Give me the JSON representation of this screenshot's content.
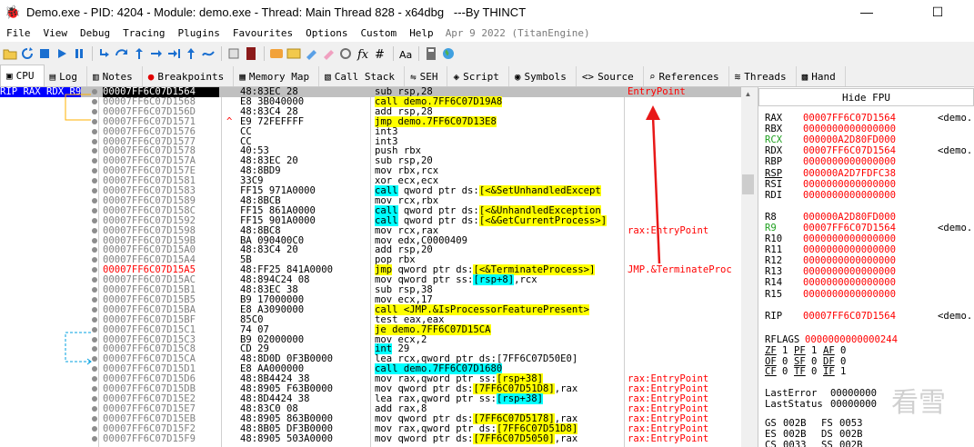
{
  "window": {
    "title": "Demo.exe - PID: 4204 - Module: demo.exe - Thread: Main Thread 828 - x64dbg   ---By THINCT",
    "minimize_glyph": "—",
    "maximize_glyph": "☐"
  },
  "menu": {
    "items": [
      "File",
      "View",
      "Debug",
      "Tracing",
      "Plugins",
      "Favourites",
      "Options",
      "Custom",
      "Help"
    ],
    "date": "Apr 9 2022 (TitanEngine)"
  },
  "toolbar": {
    "icons": [
      "open-icon",
      "restart-icon",
      "stop-icon",
      "run-icon",
      "pause-icon",
      "step-into-icon",
      "step-over-icon",
      "trace-into-icon",
      "trace-over-icon",
      "execute-till-return-icon",
      "run-to-user-code-icon",
      "scylla-icon",
      "notes-icon",
      "patch-icon",
      "comments-icon",
      "labels-icon",
      "bookmarks-icon",
      "functions-icon",
      "variables-icon",
      "font-icon",
      "calculator-icon",
      "globe-icon"
    ]
  },
  "tabs": [
    {
      "label": "CPU",
      "icon": "cpu-icon",
      "glyph": "▣",
      "active": true
    },
    {
      "label": "Log",
      "icon": "log-icon",
      "glyph": "▤"
    },
    {
      "label": "Notes",
      "icon": "notes-icon",
      "glyph": "▥"
    },
    {
      "label": "Breakpoints",
      "icon": "breakpoint-icon",
      "glyph": "●"
    },
    {
      "label": "Memory Map",
      "icon": "memory-map-icon",
      "glyph": "▦"
    },
    {
      "label": "Call Stack",
      "icon": "call-stack-icon",
      "glyph": "▧"
    },
    {
      "label": "SEH",
      "icon": "seh-icon",
      "glyph": "⇋"
    },
    {
      "label": "Script",
      "icon": "script-icon",
      "glyph": "◈"
    },
    {
      "label": "Symbols",
      "icon": "symbols-icon",
      "glyph": "◉"
    },
    {
      "label": "Source",
      "icon": "source-icon",
      "glyph": "<>"
    },
    {
      "label": "References",
      "icon": "references-icon",
      "glyph": "⌕"
    },
    {
      "label": "Threads",
      "icon": "threads-icon",
      "glyph": "≋"
    },
    {
      "label": "Hand",
      "icon": "handles-icon",
      "glyph": "▩"
    }
  ],
  "disasm": {
    "reg_label": "RIP RAX RDX R9",
    "rows": [
      {
        "addr": "00007FF6C07D1564",
        "bytes": "48:83EC 28",
        "instr": [
          [
            "mn",
            "sub "
          ],
          [
            "op",
            "rsp,28"
          ]
        ],
        "cmt": "EntryPoint",
        "sel": true
      },
      {
        "addr": "00007FF6C07D1568",
        "bytes": "E8 3B040000",
        "instr": [
          [
            "y",
            "call demo.7FF6C07D19A8"
          ]
        ]
      },
      {
        "addr": "00007FF6C07D156D",
        "bytes": "48:83C4 28",
        "instr": [
          [
            "mn",
            "add "
          ],
          [
            "op",
            "rsp,28"
          ]
        ]
      },
      {
        "addr": "00007FF6C07D1571",
        "bytes": "E9 72FEFFFF",
        "instr": [
          [
            "y",
            "jmp demo.7FF6C07D13E8"
          ]
        ],
        "arrow": "^"
      },
      {
        "addr": "00007FF6C07D1576",
        "bytes": "CC",
        "instr": [
          [
            "mn",
            "int3"
          ]
        ]
      },
      {
        "addr": "00007FF6C07D1577",
        "bytes": "CC",
        "instr": [
          [
            "mn",
            "int3"
          ]
        ]
      },
      {
        "addr": "00007FF6C07D1578",
        "bytes": "40:53",
        "instr": [
          [
            "mn",
            "push "
          ],
          [
            "op",
            "rbx"
          ]
        ]
      },
      {
        "addr": "00007FF6C07D157A",
        "bytes": "48:83EC 20",
        "instr": [
          [
            "mn",
            "sub "
          ],
          [
            "op",
            "rsp,20"
          ]
        ]
      },
      {
        "addr": "00007FF6C07D157E",
        "bytes": "48:8BD9",
        "instr": [
          [
            "mn",
            "mov "
          ],
          [
            "op",
            "rbx,rcx"
          ]
        ]
      },
      {
        "addr": "00007FF6C07D1581",
        "bytes": "33C9",
        "instr": [
          [
            "mn",
            "xor "
          ],
          [
            "op",
            "ecx,ecx"
          ]
        ]
      },
      {
        "addr": "00007FF6C07D1583",
        "bytes": "FF15 971A0000",
        "instr": [
          [
            "c",
            "call"
          ],
          [
            "op",
            " qword ptr ds:"
          ],
          [
            "y",
            "[<&SetUnhandledExcept"
          ]
        ]
      },
      {
        "addr": "00007FF6C07D1589",
        "bytes": "48:8BCB",
        "instr": [
          [
            "mn",
            "mov "
          ],
          [
            "op",
            "rcx,rbx"
          ]
        ]
      },
      {
        "addr": "00007FF6C07D158C",
        "bytes": "FF15 861A0000",
        "instr": [
          [
            "c",
            "call"
          ],
          [
            "op",
            " qword ptr ds:"
          ],
          [
            "y",
            "[<&UnhandledException"
          ]
        ]
      },
      {
        "addr": "00007FF6C07D1592",
        "bytes": "FF15 901A0000",
        "instr": [
          [
            "c",
            "call"
          ],
          [
            "op",
            " qword ptr ds:"
          ],
          [
            "y",
            "[<&GetCurrentProcess>]"
          ]
        ]
      },
      {
        "addr": "00007FF6C07D1598",
        "bytes": "48:8BC8",
        "instr": [
          [
            "mn",
            "mov "
          ],
          [
            "op",
            "rcx,rax"
          ]
        ],
        "cmt": "rax:EntryPoint"
      },
      {
        "addr": "00007FF6C07D159B",
        "bytes": "BA 090400C0",
        "instr": [
          [
            "mn",
            "mov "
          ],
          [
            "op",
            "edx,C0000409"
          ]
        ]
      },
      {
        "addr": "00007FF6C07D15A0",
        "bytes": "48:83C4 20",
        "instr": [
          [
            "mn",
            "add "
          ],
          [
            "op",
            "rsp,20"
          ]
        ]
      },
      {
        "addr": "00007FF6C07D15A4",
        "bytes": "5B",
        "instr": [
          [
            "mn",
            "pop "
          ],
          [
            "op",
            "rbx"
          ]
        ]
      },
      {
        "addr": "00007FF6C07D15A5",
        "bytes": "48:FF25 841A0000",
        "instr": [
          [
            "y",
            "jmp"
          ],
          [
            "op",
            " qword ptr ds:"
          ],
          [
            "y",
            "[<&TerminateProcess>]"
          ]
        ],
        "cmt": "JMP.&TerminateProc",
        "red": true
      },
      {
        "addr": "00007FF6C07D15AC",
        "bytes": "48:894C24 08",
        "instr": [
          [
            "mn",
            "mov "
          ],
          [
            "op",
            "qword ptr ss:"
          ],
          [
            "c",
            "[rsp+8]"
          ],
          [
            "op",
            ",rcx"
          ]
        ]
      },
      {
        "addr": "00007FF6C07D15B1",
        "bytes": "48:83EC 38",
        "instr": [
          [
            "mn",
            "sub "
          ],
          [
            "op",
            "rsp,38"
          ]
        ]
      },
      {
        "addr": "00007FF6C07D15B5",
        "bytes": "B9 17000000",
        "instr": [
          [
            "mn",
            "mov "
          ],
          [
            "op",
            "ecx,17"
          ]
        ]
      },
      {
        "addr": "00007FF6C07D15BA",
        "bytes": "E8 A3090000",
        "instr": [
          [
            "y",
            "call <JMP.&IsProcessorFeaturePresent>"
          ]
        ]
      },
      {
        "addr": "00007FF6C07D15BF",
        "bytes": "85C0",
        "instr": [
          [
            "mn",
            "test "
          ],
          [
            "op",
            "eax,eax"
          ]
        ]
      },
      {
        "addr": "00007FF6C07D15C1",
        "bytes": "74 07",
        "instr": [
          [
            "y",
            "je demo.7FF6C07D15CA"
          ]
        ]
      },
      {
        "addr": "00007FF6C07D15C3",
        "bytes": "B9 02000000",
        "instr": [
          [
            "mn",
            "mov "
          ],
          [
            "op",
            "ecx,2"
          ]
        ]
      },
      {
        "addr": "00007FF6C07D15C8",
        "bytes": "CD 29",
        "instr": [
          [
            "c",
            "int"
          ],
          [
            "op",
            " 29"
          ]
        ]
      },
      {
        "addr": "00007FF6C07D15CA",
        "bytes": "48:8D0D 0F3B0000",
        "instr": [
          [
            "mn",
            "lea "
          ],
          [
            "op",
            "rcx,qword ptr ds:[7FF6C07D50E0]"
          ]
        ]
      },
      {
        "addr": "00007FF6C07D15D1",
        "bytes": "E8 AA000000",
        "instr": [
          [
            "c",
            "call demo.7FF6C07D1680"
          ]
        ]
      },
      {
        "addr": "00007FF6C07D15D6",
        "bytes": "48:8B4424 38",
        "instr": [
          [
            "mn",
            "mov "
          ],
          [
            "op",
            "rax,qword ptr ss:"
          ],
          [
            "y",
            "[rsp+38]"
          ]
        ],
        "cmt": "rax:EntryPoint"
      },
      {
        "addr": "00007FF6C07D15DB",
        "bytes": "48:8905 F63B0000",
        "instr": [
          [
            "mn",
            "mov "
          ],
          [
            "op",
            "qword ptr ds:"
          ],
          [
            "y",
            "[7FF6C07D51D8]"
          ],
          [
            "op",
            ",rax"
          ]
        ],
        "cmt": "rax:EntryPoint"
      },
      {
        "addr": "00007FF6C07D15E2",
        "bytes": "48:8D4424 38",
        "instr": [
          [
            "mn",
            "lea "
          ],
          [
            "op",
            "rax,qword ptr ss:"
          ],
          [
            "c",
            "[rsp+38]"
          ]
        ],
        "cmt": "rax:EntryPoint"
      },
      {
        "addr": "00007FF6C07D15E7",
        "bytes": "48:83C0 08",
        "instr": [
          [
            "mn",
            "add "
          ],
          [
            "op",
            "rax,8"
          ]
        ],
        "cmt": "rax:EntryPoint"
      },
      {
        "addr": "00007FF6C07D15EB",
        "bytes": "48:8905 863B0000",
        "instr": [
          [
            "mn",
            "mov "
          ],
          [
            "op",
            "qword ptr ds:"
          ],
          [
            "y",
            "[7FF6C07D5178]"
          ],
          [
            "op",
            ",rax"
          ]
        ],
        "cmt": "rax:EntryPoint"
      },
      {
        "addr": "00007FF6C07D15F2",
        "bytes": "48:8B05 DF3B0000",
        "instr": [
          [
            "mn",
            "mov "
          ],
          [
            "op",
            "rax,qword ptr ds:"
          ],
          [
            "y",
            "[7FF6C07D51D8]"
          ]
        ],
        "cmt": "rax:EntryPoint"
      },
      {
        "addr": "00007FF6C07D15F9",
        "bytes": "48:8905 503A0000",
        "instr": [
          [
            "mn",
            "mov "
          ],
          [
            "op",
            "qword ptr ds:"
          ],
          [
            "y",
            "[7FF6C07D5050]"
          ],
          [
            "op",
            ",rax"
          ]
        ],
        "cmt": "rax:EntryPoint"
      }
    ]
  },
  "registers": {
    "hide_fpu_label": "Hide FPU",
    "groups": [
      [
        {
          "n": "RAX",
          "v": "00007FF6C07D1564",
          "i": "<demo."
        },
        {
          "n": "RBX",
          "v": "0000000000000000",
          "i": ""
        },
        {
          "n": "RCX",
          "v": "000000A2D80FD000",
          "i": ""
        },
        {
          "n": "RDX",
          "v": "00007FF6C07D1564",
          "i": "<demo."
        },
        {
          "n": "RBP",
          "v": "0000000000000000",
          "i": ""
        },
        {
          "n": "RSP",
          "v": "000000A2D7FDFC38",
          "i": "",
          "ul": true
        },
        {
          "n": "RSI",
          "v": "0000000000000000",
          "i": ""
        },
        {
          "n": "RDI",
          "v": "0000000000000000",
          "i": ""
        }
      ],
      [
        {
          "n": "R8",
          "v": "000000A2D80FD000",
          "i": ""
        },
        {
          "n": "R9",
          "v": "00007FF6C07D1564",
          "i": "<demo."
        },
        {
          "n": "R10",
          "v": "0000000000000000",
          "i": ""
        },
        {
          "n": "R11",
          "v": "0000000000000000",
          "i": ""
        },
        {
          "n": "R12",
          "v": "0000000000000000",
          "i": ""
        },
        {
          "n": "R13",
          "v": "0000000000000000",
          "i": ""
        },
        {
          "n": "R14",
          "v": "0000000000000000",
          "i": ""
        },
        {
          "n": "R15",
          "v": "0000000000000000",
          "i": ""
        }
      ],
      [
        {
          "n": "RIP",
          "v": "00007FF6C07D1564",
          "i": "<demo."
        }
      ]
    ],
    "rflags_label": "RFLAGS",
    "rflags_value": "0000000000000244",
    "flags": [
      [
        {
          "n": "ZF",
          "v": "1"
        },
        {
          "n": "PF",
          "v": "1"
        },
        {
          "n": "AF",
          "v": "0"
        }
      ],
      [
        {
          "n": "OF",
          "v": "0"
        },
        {
          "n": "SF",
          "v": "0"
        },
        {
          "n": "DF",
          "v": "0"
        }
      ],
      [
        {
          "n": "CF",
          "v": "0"
        },
        {
          "n": "TF",
          "v": "0"
        },
        {
          "n": "IF",
          "v": "1"
        }
      ]
    ],
    "last_error_label": "LastError",
    "last_error_value": "00000000",
    "last_status_label": "LastStatus",
    "last_status_value": "00000000",
    "segments": [
      [
        {
          "n": "GS",
          "v": "002B"
        },
        {
          "n": "FS",
          "v": "0053"
        }
      ],
      [
        {
          "n": "ES",
          "v": "002B"
        },
        {
          "n": "DS",
          "v": "002B"
        }
      ],
      [
        {
          "n": "CS",
          "v": "0033"
        },
        {
          "n": "SS",
          "v": "002B"
        }
      ]
    ]
  },
  "watermark": "看雪",
  "colors": {
    "accent_red": "#ff0000",
    "highlight_yellow": "#ffff00",
    "highlight_cyan": "#00ffff",
    "reg_label_blue": "#0000ff"
  }
}
